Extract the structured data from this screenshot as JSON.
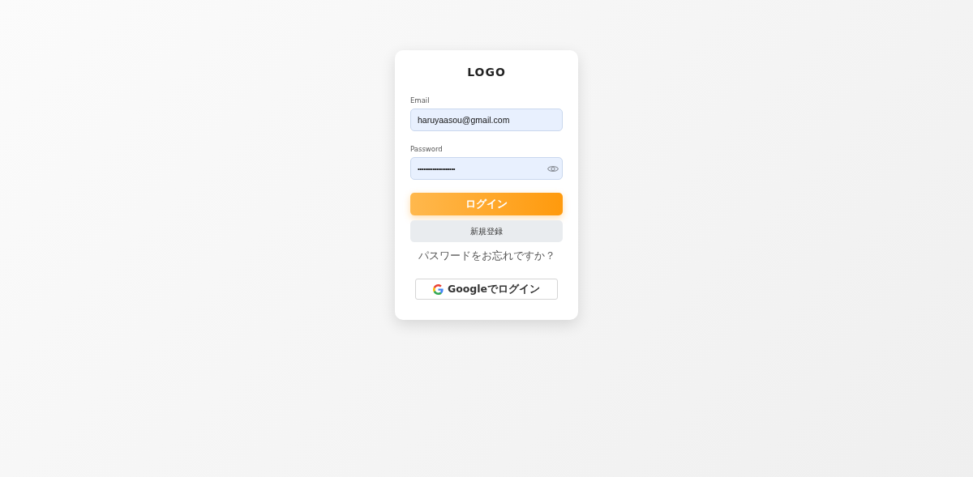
{
  "logo": "LOGO",
  "fields": [
    {
      "kind": "text",
      "label": "Email",
      "value": "haruyaasou@gmail.com"
    },
    {
      "kind": "password",
      "label": "Password",
      "value": "••••••••••••••••••••"
    }
  ],
  "login_button": "ログイン",
  "register_button": "新規登録",
  "forgot_link": "パスワードをお忘れですか？",
  "google_button": "Googleでログイン"
}
